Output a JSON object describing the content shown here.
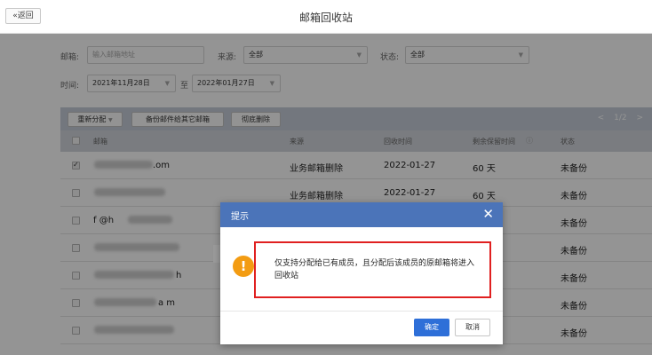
{
  "header": {
    "back_label": "«返回",
    "title": "邮箱回收站"
  },
  "filters": {
    "email_label": "邮箱:",
    "email_placeholder": "输入邮箱地址",
    "source_label": "来源:",
    "source_value": "全部",
    "status_label": "状态:",
    "status_value": "全部",
    "time_label": "时间:",
    "date_from": "2021年11月28日",
    "date_sep": "至",
    "date_to": "2022年01月27日"
  },
  "toolbar": {
    "reassign_label": "重新分配",
    "backup_label": "备份邮件给其它邮箱",
    "delete_label": "彻底删除",
    "page_indicator": "1/2"
  },
  "table": {
    "columns": [
      "邮箱",
      "来源",
      "回收时间",
      "剩余保留时间",
      "状态"
    ],
    "rows": [
      {
        "email_visible": ".om",
        "source": "业务邮箱删除",
        "time": "2022-01-27",
        "remaining": "60 天",
        "status": "未备份",
        "checked": true
      },
      {
        "email_visible": "",
        "source": "业务邮箱删除",
        "time": "2022-01-27",
        "remaining": "60 天",
        "status": "未备份",
        "checked": false
      },
      {
        "email_visible": "f @h",
        "source": "",
        "time": "",
        "remaining": "",
        "status": "未备份",
        "checked": false
      },
      {
        "email_visible": "",
        "source": "",
        "time": "",
        "remaining": "",
        "status": "未备份",
        "checked": false
      },
      {
        "email_visible": "h",
        "source": "",
        "time": "",
        "remaining": "",
        "status": "未备份",
        "checked": false
      },
      {
        "email_visible": "a m",
        "source": "",
        "time": "",
        "remaining": "",
        "status": "未备份",
        "checked": false
      },
      {
        "email_visible": "",
        "source": "",
        "time": "",
        "remaining": "",
        "status": "未备份",
        "checked": false
      }
    ]
  },
  "dialog": {
    "title": "提示",
    "close_icon": "close-icon",
    "message": "仅支持分配给已有成员，且分配后该成员的原邮箱将进入回收站",
    "ok_label": "确定",
    "cancel_label": "取消",
    "warning_icon": "!",
    "highlight_color": "#e02020",
    "header_color": "#4b74b9"
  }
}
